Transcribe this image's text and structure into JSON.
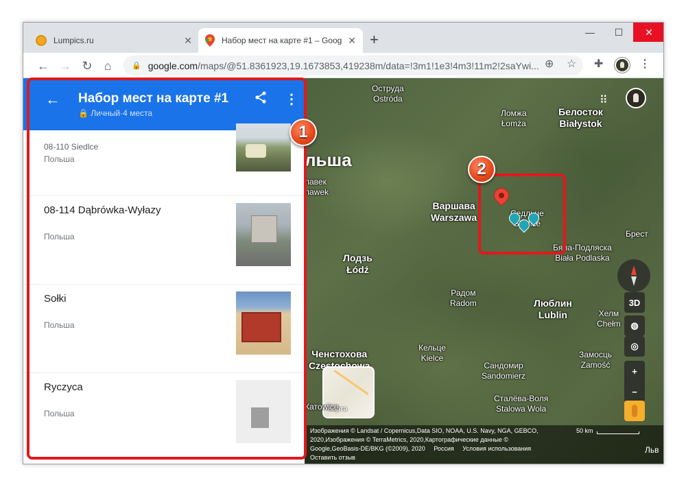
{
  "browser": {
    "tabs": [
      {
        "title": "Lumpics.ru",
        "active": false
      },
      {
        "title": "Набор мест на карте #1 – Goog",
        "active": true
      }
    ],
    "url_host": "google.com",
    "url_path": "/maps/@51.8361923,19.1673853,419238m/data=!3m1!1e3!4m3!11m2!2saYwi..."
  },
  "panel": {
    "title": "Набор мест на карте #1",
    "subtitle": "Личный·4 места",
    "places": [
      {
        "name": "08-110 Siedlce",
        "country": "Польша",
        "thumb": "car"
      },
      {
        "name": "08-114 Dąbrówka-Wyłazy",
        "country": "Польша",
        "thumb": "bldg"
      },
      {
        "name": "Sołki",
        "country": "Польша",
        "thumb": "garage"
      },
      {
        "name": "Ryczyca",
        "country": "Польша",
        "thumb": "placeholder"
      }
    ]
  },
  "map": {
    "country_label": "льша",
    "cities": [
      {
        "label": "Оструда\nOstróda",
        "big": false
      },
      {
        "label": "Ломжа\nŁomża",
        "big": false
      },
      {
        "label": "Белосток\nBiałystok",
        "big": true
      },
      {
        "label": "лавек\nлawek",
        "big": false
      },
      {
        "label": "Варшава\nWarszawa",
        "big": true
      },
      {
        "label": "Седльце\nSiedlce",
        "big": false
      },
      {
        "label": "Брест",
        "big": false
      },
      {
        "label": "Бяла-Подляска\nBiała Podlaska",
        "big": false
      },
      {
        "label": "Лодзь\nŁódź",
        "big": true
      },
      {
        "label": "Радом\nRadom",
        "big": false
      },
      {
        "label": "Люблин\nLublin",
        "big": true
      },
      {
        "label": "Хелм\nChełm",
        "big": false
      },
      {
        "label": "Ченстохова\nCzęstochowa",
        "big": true
      },
      {
        "label": "Кельце\nKielce",
        "big": false
      },
      {
        "label": "Сандомир\nSandomierz",
        "big": false
      },
      {
        "label": "Замосць\nZamość",
        "big": false
      },
      {
        "label": "Сталёва-Воля\nStalowa Wola",
        "big": false
      },
      {
        "label": "Катowice",
        "big": false
      }
    ],
    "minimap_label": "Карта",
    "controls": {
      "three_d": "3D",
      "zoom_in": "+",
      "zoom_out": "−"
    },
    "attribution_line1": "Изображения © Landsat / Copernicus,Data SIO, NOAA, U.S. Navy, NGA, GEBCO,",
    "attribution_line2": "2020,Изображения © TerraMetrics, 2020,Картографические данные ©",
    "attribution_line3": "Google,GeoBasis-DE/BKG (©2009), 2020",
    "attribution_country": "Россия",
    "attribution_terms": "Условия использования",
    "attribution_feedback": "Оставить отзыв",
    "scale_label": "50 km",
    "edge_label": "Льв"
  },
  "annotations": {
    "badge1": "1",
    "badge2": "2"
  },
  "colors": {
    "header_blue": "#1a73e8",
    "highlight_red": "#e0191d",
    "pin_red": "#ea4335",
    "pin_teal": "#1fa5b5"
  }
}
